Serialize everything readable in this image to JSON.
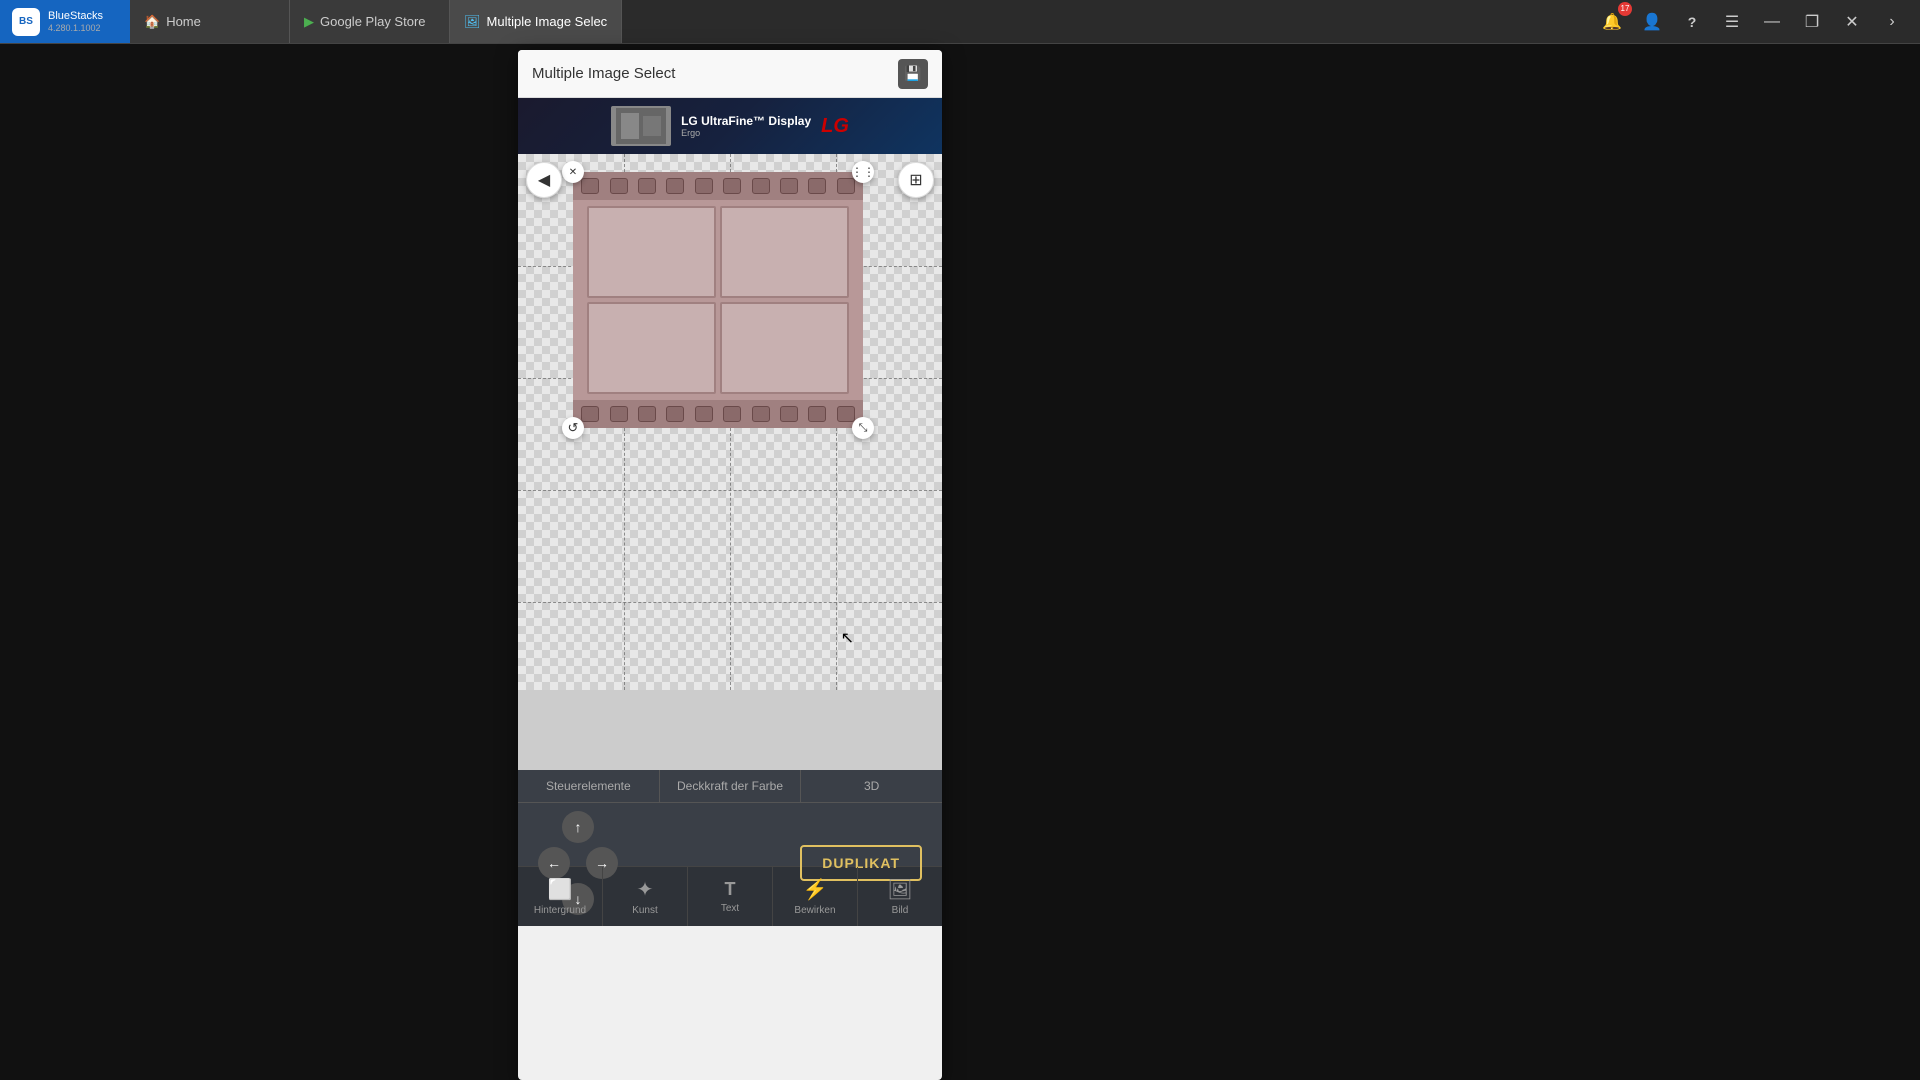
{
  "taskbar": {
    "app_name": "BlueStacks",
    "app_version": "4.280.1.1002",
    "tabs": [
      {
        "id": "home",
        "label": "Home",
        "icon": "🏠",
        "active": false
      },
      {
        "id": "play-store",
        "label": "Google Play Store",
        "icon": "▶",
        "active": false
      },
      {
        "id": "multi-image",
        "label": "Multiple Image Selec",
        "icon": "🖼",
        "active": true
      }
    ],
    "buttons": {
      "notification": "🔔",
      "notification_count": "17",
      "account": "👤",
      "help": "?",
      "menu": "☰",
      "minimize": "—",
      "restore": "❐",
      "close": "✕",
      "chevron": "›"
    }
  },
  "window": {
    "title": "Multiple Image Select",
    "save_icon": "💾"
  },
  "ad": {
    "brand": "LG UltraFine™ Display",
    "model": "Ergo",
    "label": "LG"
  },
  "canvas": {
    "tool_back": "◀",
    "tool_options": "⊞"
  },
  "handles": {
    "close": "✕",
    "options": "⋮",
    "rotate_left": "↺",
    "resize": "⤡"
  },
  "bottom_tabs": [
    {
      "id": "steuerelemente",
      "label": "Steuerelemente"
    },
    {
      "id": "deckraft",
      "label": "Deckkraft der Farbe"
    },
    {
      "id": "3d",
      "label": "3D"
    }
  ],
  "nav_arrows": {
    "up": "↑",
    "left": "←",
    "right": "→",
    "down": "↓"
  },
  "duplikat_button": "DUPLIKAT",
  "bottom_nav": [
    {
      "id": "hintergrund",
      "label": "Hintergrund",
      "icon": "⬜"
    },
    {
      "id": "kunst",
      "label": "Kunst",
      "icon": "✨"
    },
    {
      "id": "text",
      "label": "Text",
      "icon": "T"
    },
    {
      "id": "bewirken",
      "label": "Bewirken",
      "icon": "⚡"
    },
    {
      "id": "bild",
      "label": "Bild",
      "icon": "🖼"
    }
  ]
}
